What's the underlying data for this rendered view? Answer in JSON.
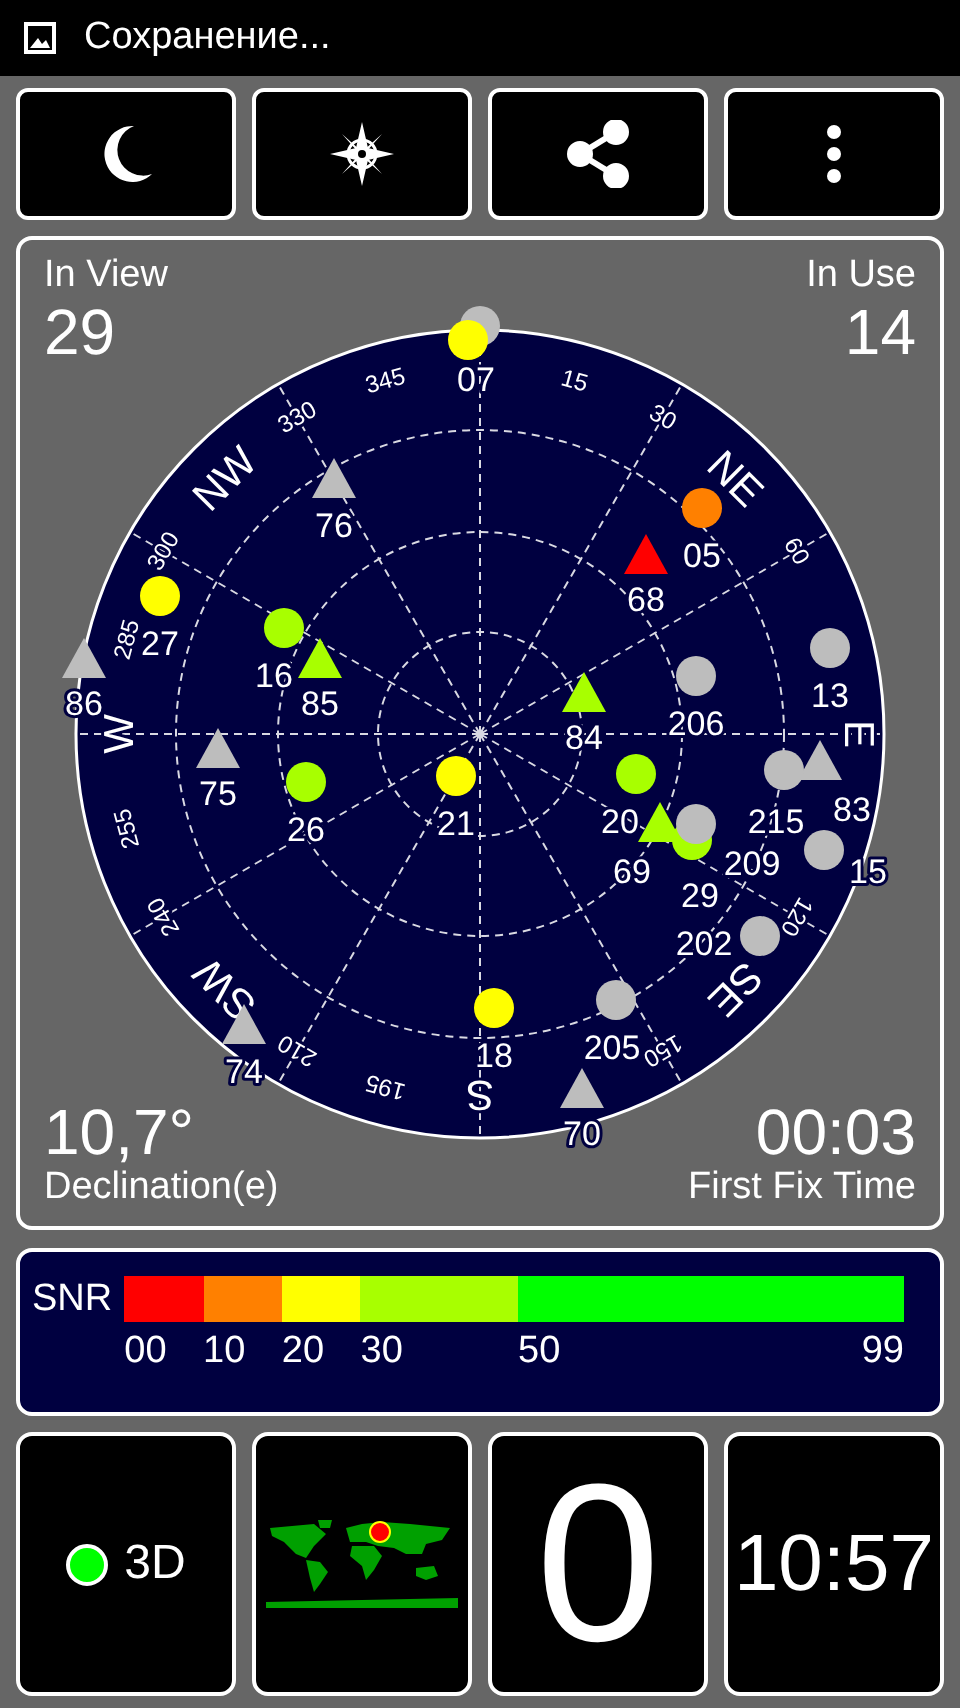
{
  "status_bar": {
    "text": "Сохранение..."
  },
  "toolbar": [
    {
      "kind": "night"
    },
    {
      "kind": "compass"
    },
    {
      "kind": "share"
    },
    {
      "kind": "more"
    }
  ],
  "sky": {
    "in_view_label": "In View",
    "in_view": "29",
    "in_use_label": "In Use",
    "in_use": "14",
    "declination": "10,7°",
    "declination_label": "Declination(e)",
    "fix_time": "00:03",
    "fix_time_label": "First Fix Time",
    "azimuth_labels": [
      {
        "text": "345",
        "kind": "degree"
      },
      {
        "text": "15",
        "kind": "degree"
      },
      {
        "text": "30",
        "kind": "degree"
      },
      {
        "text": "60",
        "kind": "degree"
      },
      {
        "text": "330",
        "kind": "degree"
      },
      {
        "text": "300",
        "kind": "degree"
      },
      {
        "text": "285",
        "kind": "degree"
      },
      {
        "text": "255",
        "kind": "degree"
      },
      {
        "text": "240",
        "kind": "degree"
      },
      {
        "text": "210",
        "kind": "degree"
      },
      {
        "text": "195",
        "kind": "degree"
      },
      {
        "text": "150",
        "kind": "degree"
      },
      {
        "text": "120",
        "kind": "degree"
      },
      {
        "text": "NW",
        "kind": "direction"
      },
      {
        "text": "NE",
        "kind": "direction"
      },
      {
        "text": "E",
        "kind": "direction"
      },
      {
        "text": "SE",
        "kind": "direction"
      },
      {
        "text": "S",
        "kind": "direction"
      },
      {
        "text": "SW",
        "kind": "direction"
      },
      {
        "text": "W",
        "kind": "direction"
      }
    ],
    "satellites": [
      {
        "color": "#bdbdbd",
        "kind": "circle"
      },
      {
        "name": "07",
        "color": "#ffff00",
        "kind": "circle"
      },
      {
        "name": "76",
        "color": "#bdbdbd",
        "kind": "triangle"
      },
      {
        "name": "05",
        "color": "#ff8000",
        "kind": "circle"
      },
      {
        "name": "68",
        "color": "#ff0000",
        "kind": "triangle"
      },
      {
        "name": "27",
        "color": "#ffff00",
        "kind": "circle"
      },
      {
        "name": "16",
        "color": "#a8ff00",
        "kind": "circle"
      },
      {
        "name": "86",
        "color": "#bdbdbd",
        "kind": "triangle"
      },
      {
        "name": "85",
        "color": "#a8ff00",
        "kind": "triangle"
      },
      {
        "name": "13",
        "color": "#bdbdbd",
        "kind": "circle"
      },
      {
        "name": "206",
        "color": "#bdbdbd",
        "kind": "circle"
      },
      {
        "name": "84",
        "color": "#a8ff00",
        "kind": "triangle"
      },
      {
        "name": "75",
        "color": "#bdbdbd",
        "kind": "triangle"
      },
      {
        "name": "83",
        "color": "#bdbdbd",
        "kind": "triangle"
      },
      {
        "name": "26",
        "color": "#a8ff00",
        "kind": "circle"
      },
      {
        "name": "21",
        "color": "#ffff00",
        "kind": "circle"
      },
      {
        "name": "20",
        "color": "#a8ff00",
        "kind": "circle"
      },
      {
        "name": "215",
        "color": "#bdbdbd",
        "kind": "circle"
      },
      {
        "name": "29",
        "color": "#a8ff00",
        "kind": "circle"
      },
      {
        "name": "69",
        "color": "#a8ff00",
        "kind": "triangle"
      },
      {
        "name": "209",
        "color": "#bdbdbd",
        "kind": "circle"
      },
      {
        "name": "15",
        "color": "#bdbdbd",
        "kind": "circle"
      },
      {
        "name": "202",
        "color": "#bdbdbd",
        "kind": "circle"
      },
      {
        "name": "205",
        "color": "#bdbdbd",
        "kind": "circle"
      },
      {
        "name": "18",
        "color": "#ffff00",
        "kind": "circle"
      },
      {
        "name": "74",
        "color": "#bdbdbd",
        "kind": "triangle"
      },
      {
        "name": "70",
        "color": "#bdbdbd",
        "kind": "triangle"
      }
    ]
  },
  "snr": {
    "label": "SNR",
    "ticks": [
      {
        "label": "00",
        "color": "#ff0000"
      },
      {
        "label": "10",
        "color": "#ff8000"
      },
      {
        "label": "20",
        "color": "#ffff00"
      },
      {
        "label": "30",
        "color": "#a8ff00"
      },
      {
        "label": "50",
        "color": "#00ff00"
      },
      {
        "label": "99"
      }
    ]
  },
  "tiles": {
    "fix": {
      "label": "3D",
      "color": "#00ff00"
    },
    "speed": "0",
    "time": "10:57"
  }
}
